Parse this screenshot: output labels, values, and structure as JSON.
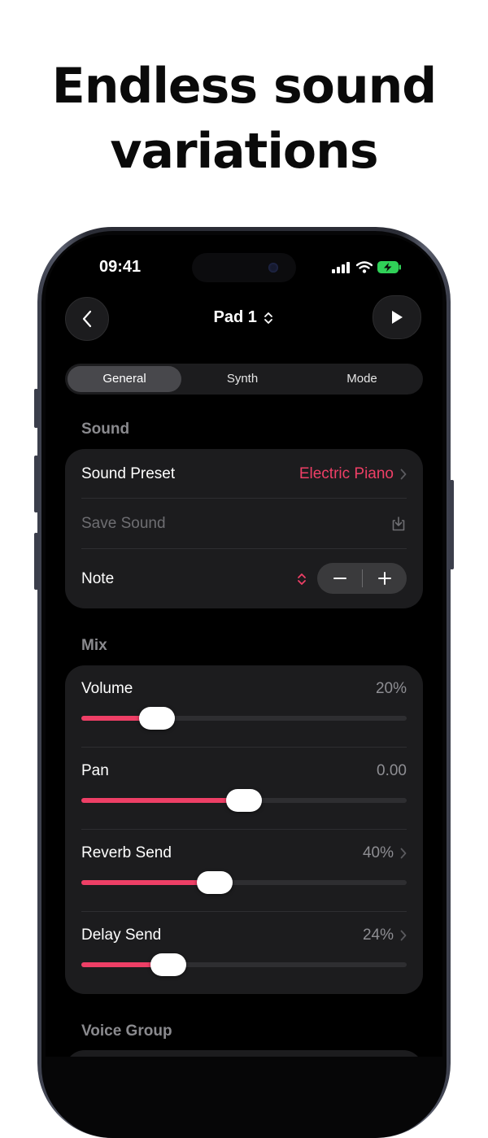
{
  "headline": {
    "line1": "Endless sound",
    "line2": "variations"
  },
  "status_bar": {
    "time": "09:41"
  },
  "nav": {
    "title": "Pad 1"
  },
  "tabs": [
    {
      "label": "General",
      "active": true
    },
    {
      "label": "Synth",
      "active": false
    },
    {
      "label": "Mode",
      "active": false
    }
  ],
  "sound": {
    "section_label": "Sound",
    "preset_label": "Sound Preset",
    "preset_value": "Electric Piano",
    "save_label": "Save Sound",
    "note_label": "Note"
  },
  "mix": {
    "section_label": "Mix",
    "sliders": [
      {
        "label": "Volume",
        "value_text": "20%",
        "level": 0.2,
        "has_chevron": false
      },
      {
        "label": "Pan",
        "value_text": "0.00",
        "level": 0.5,
        "has_chevron": false
      },
      {
        "label": "Reverb Send",
        "value_text": "40%",
        "level": 0.4,
        "has_chevron": true
      },
      {
        "label": "Delay Send",
        "value_text": "24%",
        "level": 0.24,
        "has_chevron": true
      }
    ]
  },
  "voice_group": {
    "section_label": "Voice Group"
  },
  "colors": {
    "accent": "#ee3f66",
    "card": "#1c1c1e",
    "battery": "#30d158"
  }
}
